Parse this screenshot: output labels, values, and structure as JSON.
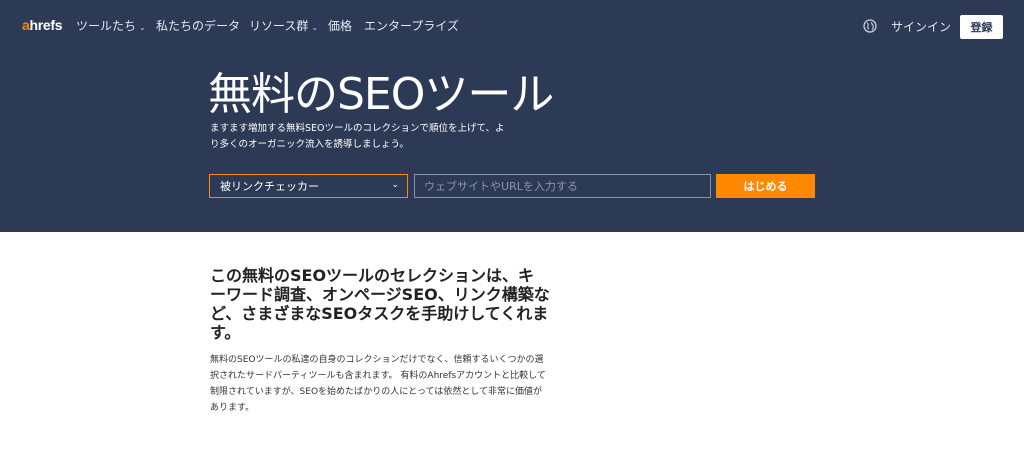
{
  "nav": {
    "logo_accent": "a",
    "logo_rest": "hrefs",
    "items": [
      {
        "label": "ツールたち",
        "chevron": "⌄"
      },
      {
        "label": "私たちのデータ",
        "chevron": ""
      },
      {
        "label": "リソース群",
        "chevron": "⌄"
      },
      {
        "label": "価格",
        "chevron": ""
      },
      {
        "label": "エンタープライズ",
        "chevron": ""
      }
    ],
    "signin_label": "サインイン",
    "register_label": "登録"
  },
  "hero": {
    "title": "無料のSEOツール",
    "subtitle": "ますます増加する無料SEOツールのコレクションで順位を上げて、より多くのオーガニック流入を誘導しましょう。",
    "tool_select_value": "被リンクチェッカー",
    "url_placeholder": "ウェブサイトやURLを入力する",
    "start_label": "はじめる"
  },
  "content": {
    "heading": "この無料のSEOツールのセレクションは、キーワード調査、オンページSEO、リンク構築など、さまざまなSEOタスクを手助けしてくれます。",
    "body": "無料のSEOツールの私達の自身のコレクションだけでなく、信頼するいくつかの選択されたサードパーティツールも含まれます。 有料のAhrefsアカウントと比較して制限されていますが、SEOを始めたばかりの人にとっては依然として非常に価値があります。"
  },
  "colors": {
    "hero_bg": "#2d3a56",
    "accent": "#ff8800"
  }
}
